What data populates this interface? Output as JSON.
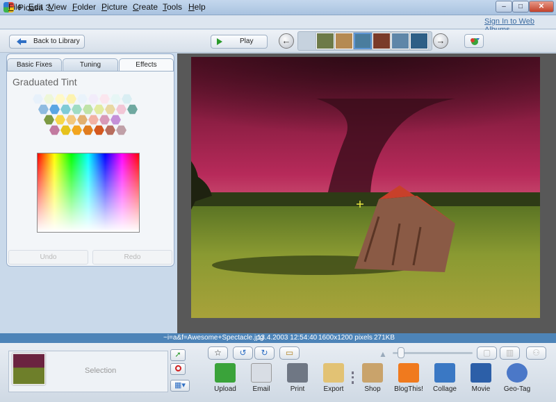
{
  "window": {
    "title": "Picasa 3",
    "min": "–",
    "max": "□",
    "close": "✕"
  },
  "menu": [
    {
      "mn": "F",
      "rest": "ile"
    },
    {
      "mn": "E",
      "rest": "dit"
    },
    {
      "mn": "V",
      "rest": "iew"
    },
    {
      "mn": "F",
      "rest": "older"
    },
    {
      "mn": "P",
      "rest": "icture"
    },
    {
      "mn": "C",
      "rest": "reate"
    },
    {
      "mn": "T",
      "rest": "ools"
    },
    {
      "mn": "H",
      "rest": "elp"
    }
  ],
  "signin": "Sign In to Web Albums",
  "toolbar": {
    "back_label": "Back to Library",
    "play_label": "Play",
    "prev": "←",
    "next": "→"
  },
  "filmstrip": [
    "#6d7a48",
    "#b58a52",
    "#4a7d9e",
    "#7a3b2a",
    "#5f86a8",
    "#2e5f86"
  ],
  "tabs": {
    "basic": "Basic Fixes",
    "tuning": "Tuning",
    "effects": "Effects"
  },
  "effect_title": "Graduated Tint",
  "swatch_rows": [
    [
      "#e7f1fb",
      "#eef7d8",
      "#fff9c7",
      "#fdf3b0",
      "#e9f3fb",
      "#f2ecfa",
      "#fbe6ee",
      "#e6f6f5",
      "#d9eef3"
    ],
    [
      "#8fbbe0",
      "#5aa6e3",
      "#7fcbd6",
      "#9fdcc3",
      "#bfe3a7",
      "#e2eba0",
      "#e8d8a2",
      "#f2c6d6",
      "#6fa8a0"
    ],
    [
      "#7c9a43",
      "#f6d74a",
      "#f2c87d",
      "#e2b070",
      "#f2b2a4",
      "#d89ab8",
      "#c490d8"
    ],
    [
      "#c27aa0",
      "#e6c21d",
      "#f2a51f",
      "#e07c1f",
      "#d4581f",
      "#b86d5e",
      "#c0a0a8"
    ]
  ],
  "buttons": {
    "undo": "Undo",
    "redo": "Redo"
  },
  "status": {
    "file": "~i=a&f=Awesome+Spectacle.jpg",
    "date": "13.4.2003 12:54:40",
    "size": "1600x1200 pixels",
    "bytes": "271KB"
  },
  "tray": {
    "label": "Selection"
  },
  "actions": [
    {
      "label": "Upload",
      "color": "#3aa33a"
    },
    {
      "label": "Email",
      "color": "#d8dde4"
    },
    {
      "label": "Print",
      "color": "#6f7784"
    },
    {
      "label": "Export",
      "color": "#e2c274"
    },
    {
      "label": "Shop",
      "color": "#c9a36b"
    },
    {
      "label": "BlogThis!",
      "color": "#f07a1e"
    },
    {
      "label": "Collage",
      "color": "#3a78c4"
    },
    {
      "label": "Movie",
      "color": "#2c5fa8"
    },
    {
      "label": "Geo-Tag",
      "color": "#4b78c8"
    }
  ],
  "colors": {
    "accent": "#4d84b8",
    "photo_sky": "#b72a5a"
  }
}
